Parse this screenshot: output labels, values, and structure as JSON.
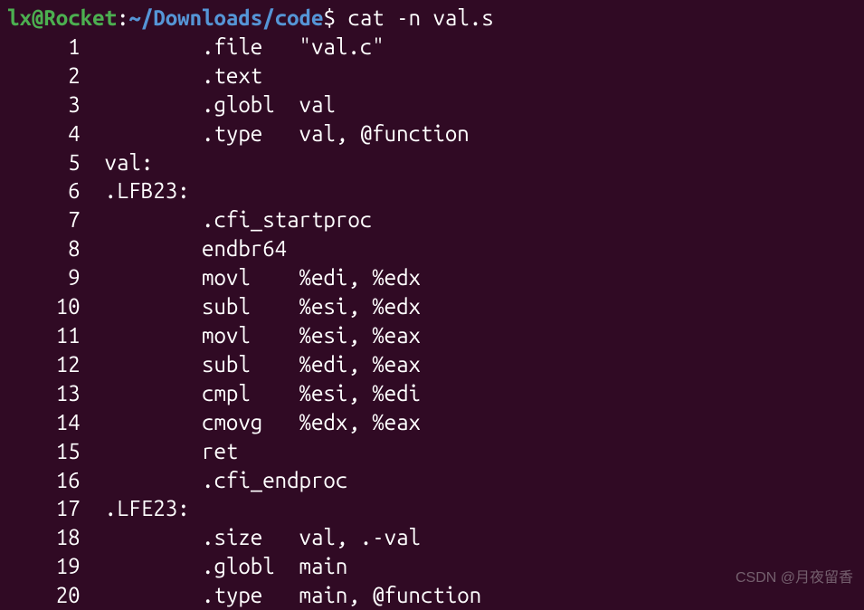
{
  "prompt": {
    "user_host": "lx@Rocket",
    "colon": ":",
    "path": "~/Downloads/code",
    "dollar": "$",
    "command": "cat -n val.s"
  },
  "lines": [
    {
      "num": "1",
      "text": "        .file   \"val.c\""
    },
    {
      "num": "2",
      "text": "        .text"
    },
    {
      "num": "3",
      "text": "        .globl  val"
    },
    {
      "num": "4",
      "text": "        .type   val, @function"
    },
    {
      "num": "5",
      "text": "val:"
    },
    {
      "num": "6",
      "text": ".LFB23:"
    },
    {
      "num": "7",
      "text": "        .cfi_startproc"
    },
    {
      "num": "8",
      "text": "        endbr64"
    },
    {
      "num": "9",
      "text": "        movl    %edi, %edx"
    },
    {
      "num": "10",
      "text": "        subl    %esi, %edx"
    },
    {
      "num": "11",
      "text": "        movl    %esi, %eax"
    },
    {
      "num": "12",
      "text": "        subl    %edi, %eax"
    },
    {
      "num": "13",
      "text": "        cmpl    %esi, %edi"
    },
    {
      "num": "14",
      "text": "        cmovg   %edx, %eax"
    },
    {
      "num": "15",
      "text": "        ret"
    },
    {
      "num": "16",
      "text": "        .cfi_endproc"
    },
    {
      "num": "17",
      "text": ".LFE23:"
    },
    {
      "num": "18",
      "text": "        .size   val, .-val"
    },
    {
      "num": "19",
      "text": "        .globl  main"
    },
    {
      "num": "20",
      "text": "        .type   main, @function"
    }
  ],
  "watermark": "CSDN @月夜留香"
}
